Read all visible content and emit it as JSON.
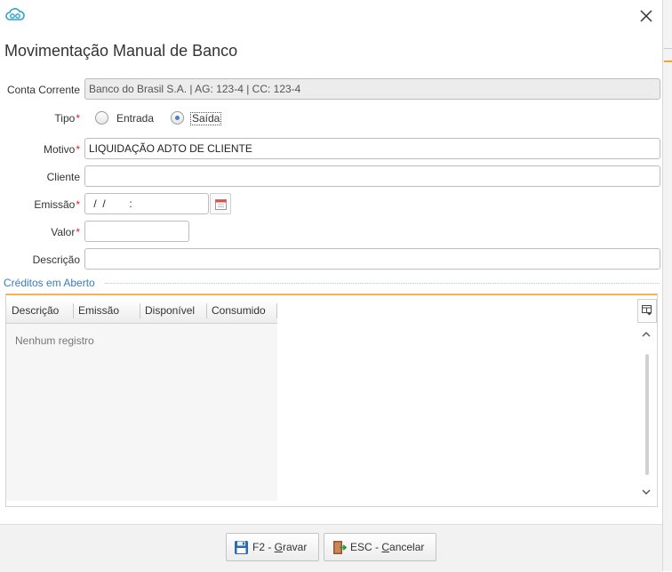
{
  "window": {
    "logo_icon": "cloud-logo-icon",
    "title": "Movimentação Manual de Banco",
    "close_icon": "close-icon"
  },
  "form": {
    "conta_corrente": {
      "label": "Conta Corrente",
      "value": "Banco do Brasil S.A. | AG: 123-4 | CC: 123-4"
    },
    "tipo": {
      "label": "Tipo",
      "required_mark": "*",
      "options": [
        "Entrada",
        "Saída"
      ],
      "selected": "Saída"
    },
    "motivo": {
      "label": "Motivo",
      "required_mark": "*",
      "value": "LIQUIDAÇÃO ADTO DE CLIENTE"
    },
    "cliente": {
      "label": "Cliente",
      "value": ""
    },
    "emissao": {
      "label": "Emissão",
      "required_mark": "*",
      "value": " /  /        :",
      "calendar_icon": "calendar-icon"
    },
    "valor": {
      "label": "Valor",
      "required_mark": "*",
      "value": ""
    },
    "descricao": {
      "label": "Descrição",
      "value": ""
    }
  },
  "creditos": {
    "section_title": "Créditos em Aberto",
    "columns": [
      "Descrição",
      "Emissão",
      "Disponível",
      "Consumido"
    ],
    "empty_message": "Nenhum registro",
    "menu_icon": "grid-menu-icon"
  },
  "footer": {
    "save": {
      "prefix": "F2 - ",
      "accel": "G",
      "rest": "ravar",
      "icon": "floppy-disk-icon"
    },
    "cancel": {
      "prefix": "ESC - ",
      "accel": "C",
      "rest": "ancelar",
      "icon": "exit-door-icon"
    }
  },
  "colors": {
    "accent": "#3a7bbf",
    "required": "#d9261c",
    "grid_top": "#f3b456"
  }
}
